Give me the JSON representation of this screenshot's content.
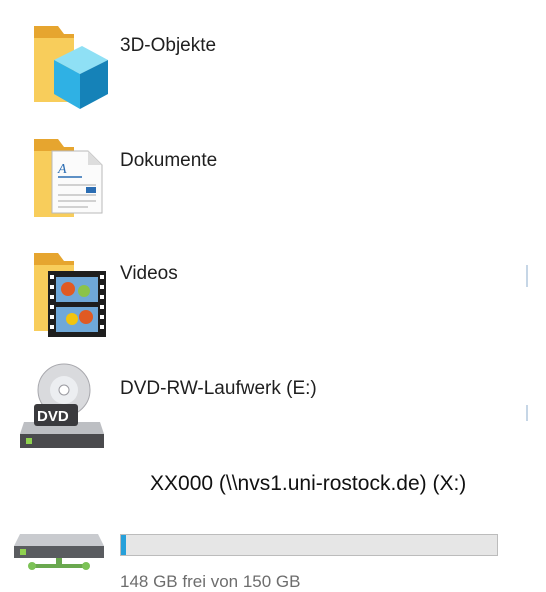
{
  "items": [
    {
      "name": "3D-Objekte",
      "icon": "folder-3d-objects-icon"
    },
    {
      "name": "Dokumente",
      "icon": "folder-documents-icon"
    },
    {
      "name": "Videos",
      "icon": "folder-videos-icon"
    },
    {
      "name": "DVD-RW-Laufwerk (E:)",
      "icon": "dvd-drive-icon"
    }
  ],
  "network_drive": {
    "name": "XX000 (\\\\nvs1.uni-rostock.de) (X:)",
    "icon": "network-drive-icon",
    "free_text": "148 GB frei von 150 GB",
    "used_fraction": 0.013
  },
  "colors": {
    "folder": "#f5c64d",
    "cube": "#2fb1e4",
    "progress": "#26a0da"
  }
}
